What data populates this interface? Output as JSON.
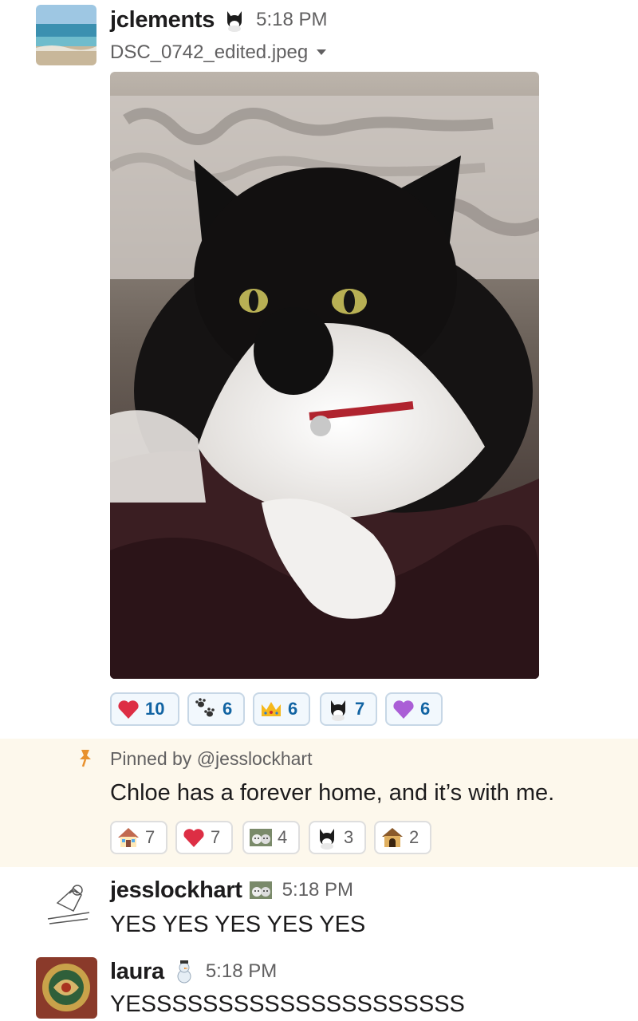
{
  "messages": [
    {
      "username": "jclements",
      "time": "5:18 PM",
      "file_name": "DSC_0742_edited.jpeg",
      "reactions": [
        {
          "emoji": "heart",
          "count": "10"
        },
        {
          "emoji": "paw-prints",
          "count": "6"
        },
        {
          "emoji": "crown",
          "count": "6"
        },
        {
          "emoji": "tuxedo-cat",
          "count": "7"
        },
        {
          "emoji": "purple-heart",
          "count": "6"
        }
      ]
    },
    {
      "pinned_by": "Pinned by @jesslockhart",
      "text": "Chloe has a forever home, and it’s with me.",
      "reactions": [
        {
          "emoji": "house",
          "count": "7"
        },
        {
          "emoji": "heart",
          "count": "7"
        },
        {
          "emoji": "cats",
          "count": "4"
        },
        {
          "emoji": "tuxedo-cat",
          "count": "3"
        },
        {
          "emoji": "dog-house",
          "count": "2"
        }
      ]
    },
    {
      "username": "jesslockhart",
      "time": "5:18 PM",
      "text": "YES YES YES YES YES"
    },
    {
      "username": "laura",
      "time": "5:18 PM",
      "text": "YESSSSSSSSSSSSSSSSSSSSS"
    }
  ],
  "colors": {
    "pinned_bg": "#fdf8ec",
    "pin_icon": "#e8912d",
    "reaction_active_bg": "#f2f8fd",
    "reaction_active_count": "#1264a3"
  }
}
